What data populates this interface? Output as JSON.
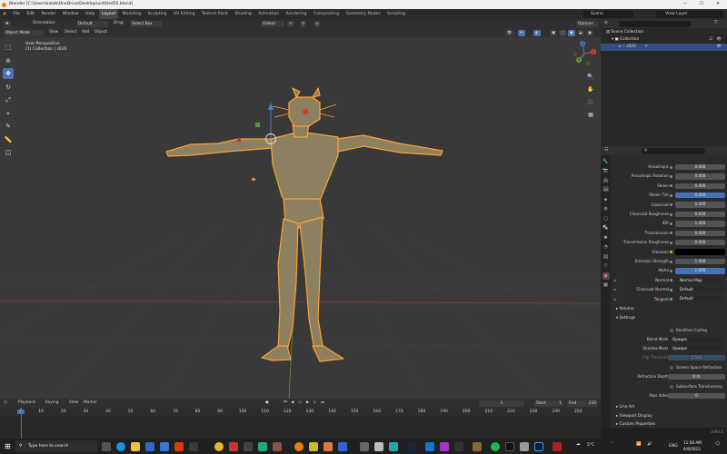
{
  "window": {
    "title": "Blender [C:\\Users\\kaleb\\OneDrive\\Desktop\\untitled55.blend]"
  },
  "menu": {
    "items": [
      "File",
      "Edit",
      "Render",
      "Window",
      "Help"
    ]
  },
  "workspaces": [
    "Layout",
    "Modeling",
    "Sculpting",
    "UV Editing",
    "Texture Paint",
    "Shading",
    "Animation",
    "Rendering",
    "Compositing",
    "Geometry Nodes",
    "Scripting"
  ],
  "active_workspace": "Layout",
  "scene": {
    "label": "Scene",
    "view_layer": "View Layer"
  },
  "tool_header": {
    "orientation_label": "Orientation:",
    "orientation_value": "Default",
    "drag_label": "Drag:",
    "drag_value": "Select Box",
    "transform_orientation": "Global",
    "options_label": "Options"
  },
  "viewport_header": {
    "mode": "Object Mode",
    "menus": [
      "View",
      "Select",
      "Add",
      "Object"
    ]
  },
  "viewport_info": {
    "line1": "User Perspective",
    "line2": "(1) Collection | s026"
  },
  "gizmo": {
    "x_label": "X",
    "y_label": "Y",
    "z_label": "Z"
  },
  "outliner": {
    "root": "Scene Collection",
    "collection": "Collection",
    "object": "s026"
  },
  "properties": {
    "rows": [
      {
        "label": "Anisotropic",
        "value": "0.000",
        "style": "normal"
      },
      {
        "label": "Anisotropic Rotation",
        "value": "0.000",
        "style": "normal"
      },
      {
        "label": "Sheen",
        "value": "0.000",
        "style": "normal"
      },
      {
        "label": "Sheen Tint",
        "value": "0.500",
        "style": "blue"
      },
      {
        "label": "Clearcoat",
        "value": "0.000",
        "style": "normal"
      },
      {
        "label": "Clearcoat Roughness",
        "value": "0.030",
        "style": "normal"
      },
      {
        "label": "IOR",
        "value": "1.450",
        "style": "normal"
      },
      {
        "label": "Transmission",
        "value": "0.000",
        "style": "normal"
      },
      {
        "label": "Transmission Roughness",
        "value": "0.000",
        "style": "normal"
      },
      {
        "label": "Emission",
        "value": "",
        "style": "black"
      },
      {
        "label": "Emission Strength",
        "value": "1.000",
        "style": "normal"
      },
      {
        "label": "Alpha",
        "value": "1.000",
        "style": "blue"
      },
      {
        "label": "Normal",
        "value": "Normal Map",
        "style": "sel"
      },
      {
        "label": "Clearcoat Normal",
        "value": "Default",
        "style": "sel"
      },
      {
        "label": "Tangent",
        "value": "Default",
        "style": "sel"
      }
    ],
    "volume_section": "Volume",
    "settings_section": "Settings",
    "backface_culling": "Backface Culling",
    "blend_mode_label": "Blend Mode",
    "blend_mode_value": "Opaque",
    "shadow_mode_label": "Shadow Mode",
    "shadow_mode_value": "Opaque",
    "clip_threshold_label": "Clip Threshold",
    "clip_threshold_value": "0.500",
    "screen_space_refraction": "Screen Space Refraction",
    "refraction_depth_label": "Refraction Depth",
    "refraction_depth_value": "0 m",
    "subsurface_translucency": "Subsurface Translucency",
    "pass_index_label": "Pass Index",
    "pass_index_value": "0",
    "line_art_section": "Line Art",
    "viewport_display_section": "Viewport Display",
    "custom_properties_section": "Custom Properties"
  },
  "timeline": {
    "menus": [
      "Playback",
      "Keying",
      "View",
      "Marker"
    ],
    "current_frame": "1",
    "start_label": "Start",
    "start_value": "1",
    "end_label": "End",
    "end_value": "250",
    "ruler": [
      "1",
      "10",
      "20",
      "30",
      "40",
      "50",
      "60",
      "70",
      "80",
      "90",
      "100",
      "110",
      "120",
      "130",
      "140",
      "150",
      "160",
      "170",
      "180",
      "190",
      "200",
      "210",
      "220",
      "230",
      "240",
      "250"
    ],
    "playhead_frame": 1
  },
  "status": {
    "version": "2.93.5"
  },
  "taskbar": {
    "search_placeholder": "Type here to search",
    "weather": "5°C",
    "lang": "ENG",
    "time": "11:56 AM",
    "date": "4/8/2023"
  },
  "colors": {
    "accent": "#4772b3",
    "selection": "#ffa032",
    "model": "#8c8060"
  }
}
